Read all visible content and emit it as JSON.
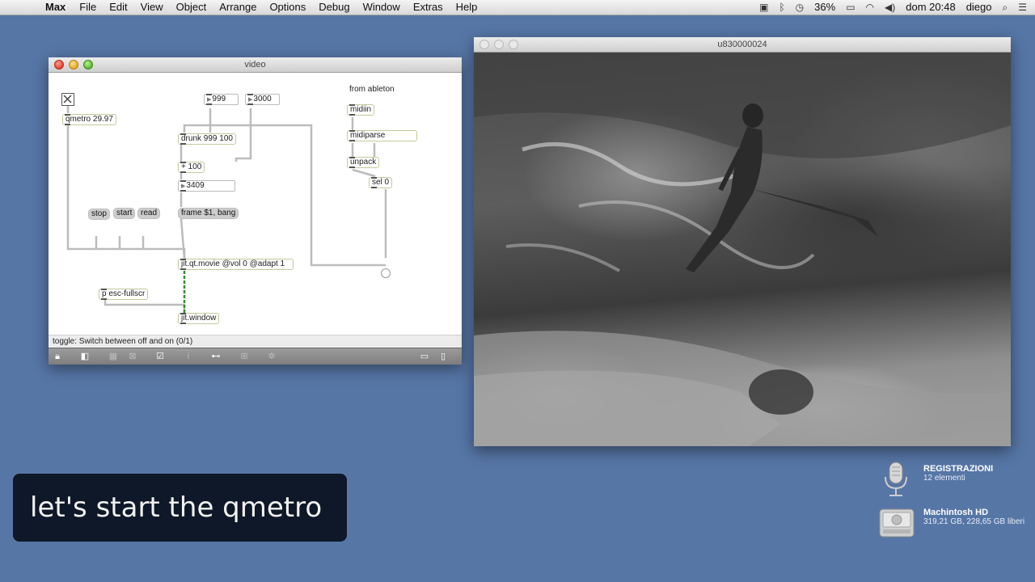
{
  "menubar": {
    "apple": "",
    "items": [
      "Max",
      "File",
      "Edit",
      "View",
      "Object",
      "Arrange",
      "Options",
      "Debug",
      "Window",
      "Extras",
      "Help"
    ],
    "battery": "36%",
    "clock": "dom 20:48",
    "user": "diego"
  },
  "patcher": {
    "title": "video",
    "objects": {
      "qmetro": "qmetro 29.97",
      "drunk": "drunk 999 100",
      "plus": "+ 100",
      "jit_movie": "jit.qt.movie @vol 0 @adapt 1",
      "esc": "p esc-fullscr",
      "jit_window": "jit.window",
      "midiin": "midiin",
      "midiparse": "midiparse",
      "unpack": "unpack",
      "sel": "sel 0"
    },
    "numbers": {
      "n1": "999",
      "n2": "3000",
      "n3": "3409"
    },
    "messages": {
      "stop": "stop",
      "start": "start",
      "read": "read",
      "frame": "frame $1, bang"
    },
    "comment": "from ableton",
    "status_text": "toggle: Switch between off and on (0/1)"
  },
  "video_window": {
    "title": "u830000024"
  },
  "subtitle": "let's start the qmetro",
  "desktop": {
    "items": [
      {
        "name": "REGISTRAZIONI",
        "sub": "12 elementi"
      },
      {
        "name": "Machintosh HD",
        "sub": "319,21 GB, 228,65 GB liberi"
      }
    ]
  }
}
